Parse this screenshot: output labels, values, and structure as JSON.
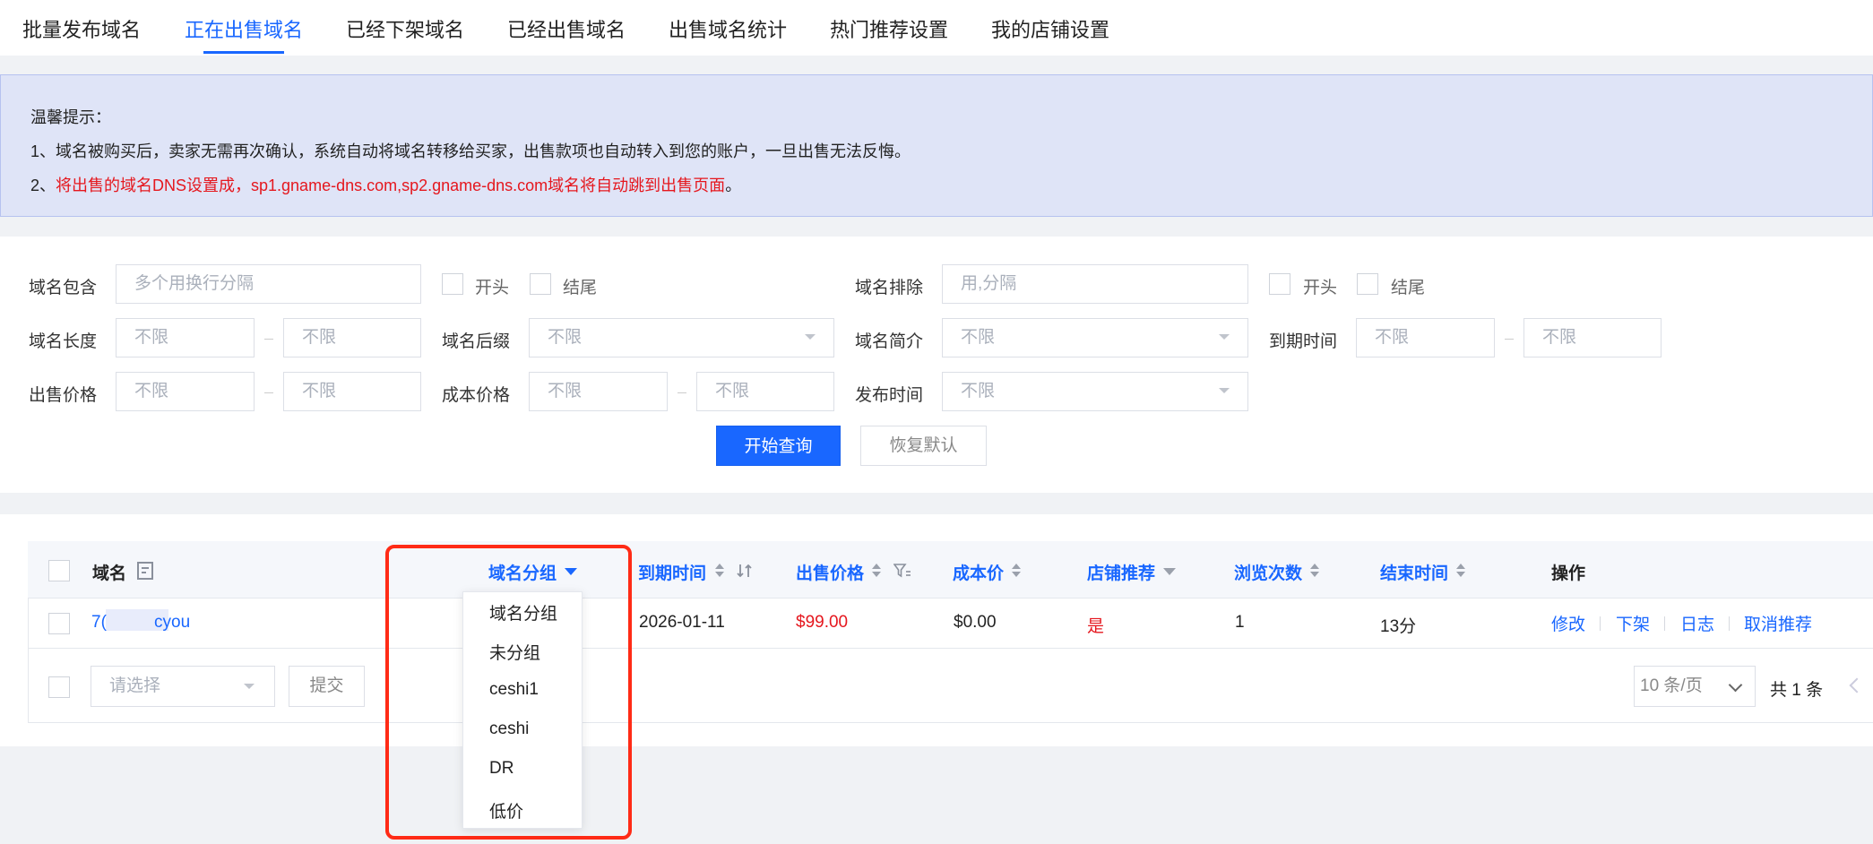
{
  "tabs": [
    {
      "label": "批量发布域名"
    },
    {
      "label": "正在出售域名"
    },
    {
      "label": "已经下架域名"
    },
    {
      "label": "已经出售域名"
    },
    {
      "label": "出售域名统计"
    },
    {
      "label": "热门推荐设置"
    },
    {
      "label": "我的店铺设置"
    }
  ],
  "notice": {
    "title": "温馨提示：",
    "line1": "1、域名被购买后，卖家无需再次确认，系统自动将域名转移给买家，出售款项也自动转入到您的账户，一旦出售无法反悔。",
    "line2_prefix": "2、",
    "line2_red": "将出售的域名DNS设置成，sp1.gname-dns.com,sp2.gname-dns.com域名将自动跳到出售页面",
    "line2_suffix": "。"
  },
  "filters": {
    "contains_label": "域名包含",
    "contains_placeholder": "多个用换行分隔",
    "start_label": "开头",
    "end_label": "结尾",
    "exclude_label": "域名排除",
    "exclude_placeholder": "用,分隔",
    "length_label": "域名长度",
    "suffix_label": "域名后缀",
    "intro_label": "域名简介",
    "expire_label": "到期时间",
    "price_label": "出售价格",
    "cost_label": "成本价格",
    "publish_label": "发布时间",
    "unlimited": "不限",
    "search_button": "开始查询",
    "reset_button": "恢复默认"
  },
  "table": {
    "headers": {
      "domain": "域名",
      "group": "域名分组",
      "expire": "到期时间",
      "price": "出售价格",
      "cost": "成本价",
      "recommend": "店铺推荐",
      "views": "浏览次数",
      "end_time": "结束时间",
      "actions": "操作"
    },
    "rows": [
      {
        "domain_prefix": "7(",
        "domain_suffix": "cyou",
        "expire": "2026-01-11",
        "price": "$99.00",
        "cost": "$0.00",
        "recommend": "是",
        "views": "1",
        "end_time": "13分"
      }
    ],
    "actions": [
      "修改",
      "下架",
      "日志",
      "取消推荐"
    ],
    "footer": {
      "select_placeholder": "请选择",
      "submit": "提交",
      "page_size": "10 条/页",
      "total": "共 1 条"
    }
  },
  "group_dropdown": {
    "options": [
      "域名分组",
      "未分组",
      "ceshi1",
      "ceshi",
      "DR",
      "低价"
    ]
  },
  "colors": {
    "primary": "#1967ff",
    "danger": "#e5171e",
    "highlight": "#ff2b16"
  }
}
